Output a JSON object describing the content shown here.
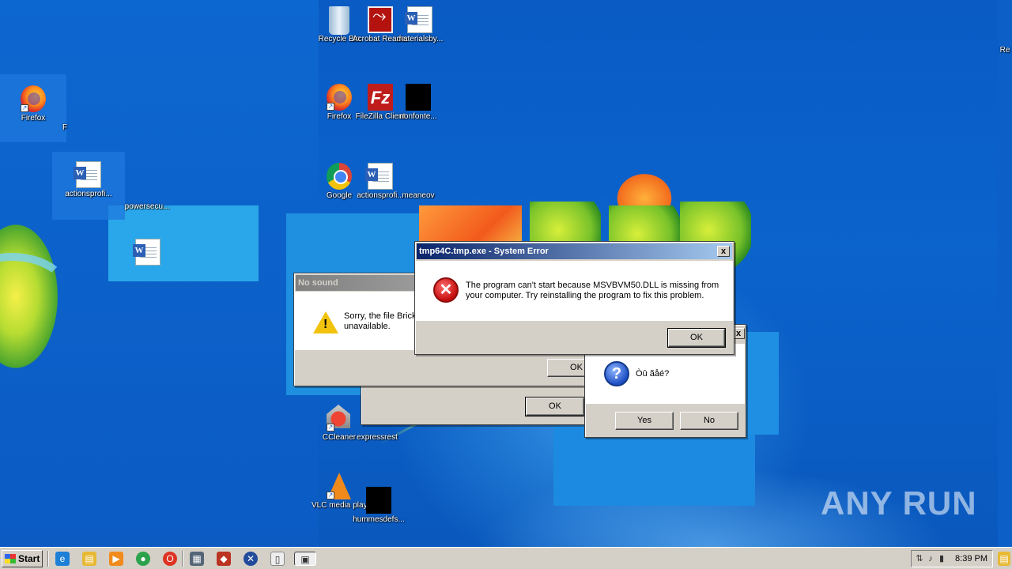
{
  "desktop": {
    "icons": [
      {
        "label": "Firefox"
      },
      {
        "label": "F"
      },
      {
        "label": "actionsprofi..."
      },
      {
        "label": "powersecu..."
      },
      {
        "label": "Recycle Bin"
      },
      {
        "label": "Acrobat Reader DC"
      },
      {
        "label": "materialsby..."
      },
      {
        "label": "Firefox"
      },
      {
        "label": "FileZilla Client"
      },
      {
        "label": "nonfonte..."
      },
      {
        "label": "Google"
      },
      {
        "label": "actionsprofi..."
      },
      {
        "label": "meaneov"
      },
      {
        "label": "CCleaner"
      },
      {
        "label": "expressrest"
      },
      {
        "label": "VLC media player"
      },
      {
        "label": "hummesdefs..."
      },
      {
        "label": "Re"
      }
    ],
    "watermark": "ANY RUN"
  },
  "dialogs": {
    "system_error": {
      "title": "tmp64C.tmp.exe - System Error",
      "message": "The program can't start because MSVBVM50.DLL is missing from your computer. Try reinstalling the program to fix this problem.",
      "ok": "OK",
      "close": "x"
    },
    "no_sound": {
      "title": "No sound",
      "message": "Sorry, the file Brick unavailable.",
      "ok": "OK"
    },
    "behind": {
      "ok": "OK"
    },
    "question": {
      "message": "Òû ãåé?",
      "yes": "Yes",
      "no": "No",
      "close": "x"
    }
  },
  "taskbar": {
    "start": "Start",
    "clock": "8:39 PM"
  },
  "colors": {
    "desktop_blue": "#0b5fc7",
    "title_active": "#0a246a",
    "dialog_face": "#d4d0c8"
  }
}
